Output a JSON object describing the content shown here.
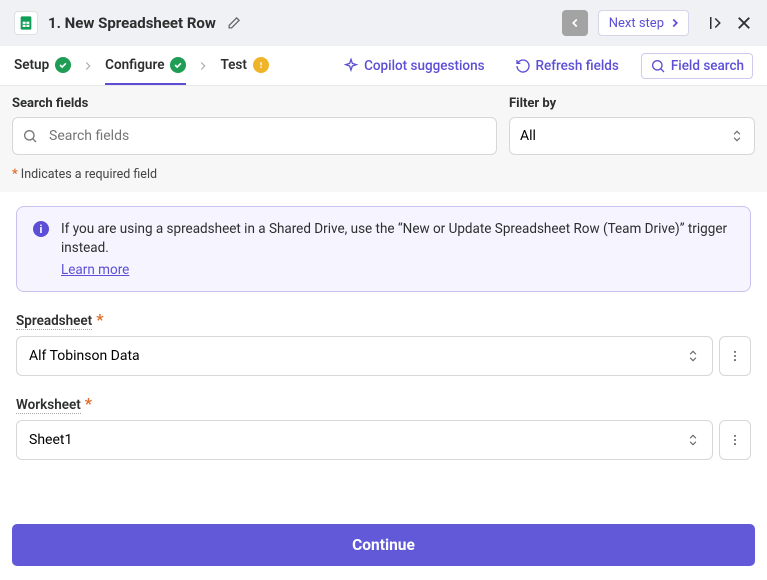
{
  "header": {
    "title": "1. New Spreadsheet Row",
    "next_label": "Next step"
  },
  "steps": {
    "setup": "Setup",
    "configure": "Configure",
    "test": "Test"
  },
  "toolbar": {
    "copilot": "Copilot suggestions",
    "refresh": "Refresh fields",
    "search": "Field search"
  },
  "filter": {
    "search_label": "Search fields",
    "search_placeholder": "Search fields",
    "filter_label": "Filter by",
    "filter_value": "All"
  },
  "required_note": "Indicates a required field",
  "info": {
    "text": "If you are using a spreadsheet in a Shared Drive, use the “New or Update Spreadsheet Row (Team Drive)” trigger instead.",
    "learn": "Learn more"
  },
  "fields": {
    "spreadsheet_label": "Spreadsheet",
    "spreadsheet_value": "Alf Tobinson Data",
    "worksheet_label": "Worksheet",
    "worksheet_value": "Sheet1"
  },
  "footer": {
    "continue": "Continue"
  }
}
